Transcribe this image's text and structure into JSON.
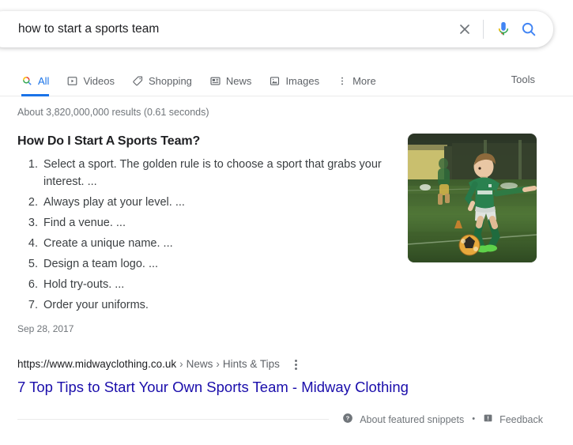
{
  "search": {
    "query": "how to start a sports team",
    "placeholder": "Search",
    "clear_icon": "close-icon",
    "mic_icon": "microphone-icon",
    "search_icon": "search-icon"
  },
  "tabs": {
    "items": [
      {
        "label": "All",
        "icon": "search-icon",
        "active": true
      },
      {
        "label": "Videos",
        "icon": "video-icon",
        "active": false
      },
      {
        "label": "Shopping",
        "icon": "tag-icon",
        "active": false
      },
      {
        "label": "News",
        "icon": "news-icon",
        "active": false
      },
      {
        "label": "Images",
        "icon": "image-icon",
        "active": false
      },
      {
        "label": "More",
        "icon": "more-vertical-icon",
        "active": false
      }
    ],
    "tools_label": "Tools"
  },
  "result_stats": "About 3,820,000,000 results (0.61 seconds)",
  "snippet": {
    "title": "How Do I Start A Sports Team?",
    "steps": [
      "Select a sport. The golden rule is to choose a sport that grabs your interest. ...",
      "Always play at your level. ...",
      "Find a venue. ...",
      "Create a unique name. ...",
      "Design a team logo. ...",
      "Hold try-outs. ...",
      "Order your uniforms."
    ],
    "date": "Sep 28, 2017",
    "thumbnail_alt": "boy-kicking-soccer-ball-photo"
  },
  "result": {
    "url": "https://www.midwayclothing.co.uk",
    "breadcrumbs": [
      "News",
      "Hints & Tips"
    ],
    "separator": "›",
    "title": "7 Top Tips to Start Your Own Sports Team - Midway Clothing"
  },
  "footer": {
    "about_label": "About featured snippets",
    "separator": "•",
    "feedback_label": "Feedback"
  },
  "colors": {
    "link_blue": "#1a0dab",
    "accent_blue": "#1a73e8",
    "text_primary": "#202124",
    "text_secondary": "#70757a",
    "google_red": "#ea4335",
    "google_yellow": "#fbbc04",
    "google_green": "#34a853"
  }
}
